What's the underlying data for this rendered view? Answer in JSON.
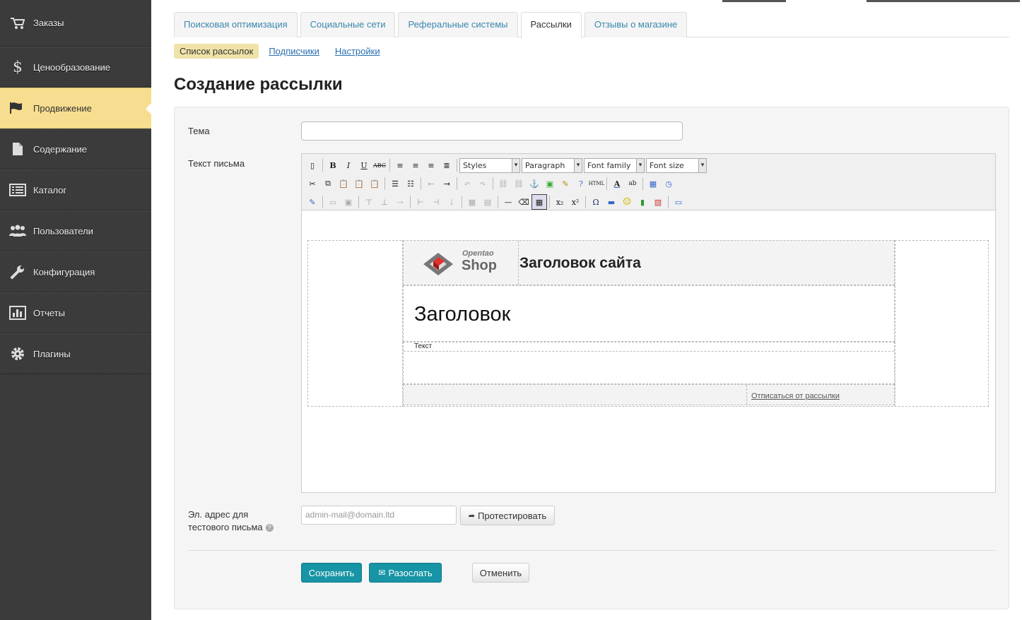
{
  "sidebar": {
    "items": [
      {
        "label": "Заказы",
        "icon": "cart-icon",
        "active": false
      },
      {
        "label": "Ценообразование",
        "icon": "dollar-icon",
        "active": false
      },
      {
        "label": "Продвижение",
        "icon": "flag-icon",
        "active": true
      },
      {
        "label": "Содержание",
        "icon": "document-icon",
        "active": false
      },
      {
        "label": "Каталог",
        "icon": "list-icon",
        "active": false
      },
      {
        "label": "Пользователи",
        "icon": "users-icon",
        "active": false
      },
      {
        "label": "Конфигурация",
        "icon": "wrench-icon",
        "active": false
      },
      {
        "label": "Отчеты",
        "icon": "chart-icon",
        "active": false
      },
      {
        "label": "Плагины",
        "icon": "gear-icon",
        "active": false
      }
    ]
  },
  "tabs": [
    {
      "label": "Поисковая оптимизация",
      "active": false
    },
    {
      "label": "Социальные сети",
      "active": false
    },
    {
      "label": "Реферальные системы",
      "active": false
    },
    {
      "label": "Рассылки",
      "active": true
    },
    {
      "label": "Отзывы о магазине",
      "active": false
    }
  ],
  "subnav": {
    "active": "Список рассылок",
    "links": [
      "Подписчики",
      "Настройки"
    ]
  },
  "page_title": "Создание рассылки",
  "form": {
    "subject_label": "Тема",
    "subject_value": "",
    "body_label": "Текст письма",
    "test_email_label_1": "Эл. адрес для",
    "test_email_label_2": "тестового письма",
    "test_email_placeholder": "admin-mail@domain.ltd",
    "test_button": "Протестировать",
    "save_button": "Сохранить",
    "send_button": "Разослать",
    "cancel_button": "Отменить"
  },
  "editor": {
    "selects": [
      "Styles",
      "Paragraph",
      "Font family",
      "Font size"
    ],
    "template": {
      "logo_small": "Opentao",
      "logo_big": "Shop",
      "site_title": "Заголовок сайта",
      "headline": "Заголовок",
      "text": "Текст",
      "unsubscribe": "Отписаться от рассылки"
    }
  },
  "colors": {
    "sidebar_bg": "#3a3a3a",
    "sidebar_active": "#f7dd8f",
    "primary_button": "#1794a5",
    "link": "#3a87ad"
  }
}
